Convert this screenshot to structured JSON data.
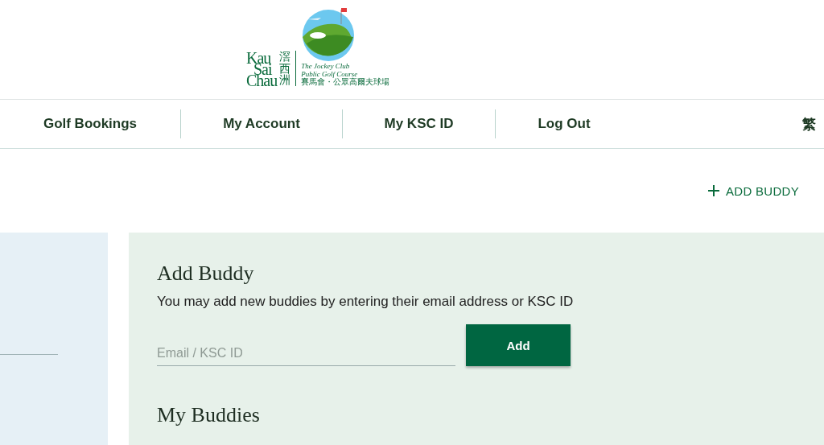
{
  "logo": {
    "name_lines": [
      "Kau",
      "Sai",
      "Chau"
    ],
    "chinese_name": "滘西洲",
    "subtitle_lines": [
      "The Jockey Club",
      "Public Golf Course"
    ],
    "chinese_subtitle": "賽馬會・公眾高爾夫球場"
  },
  "nav": [
    {
      "label": "Golf Bookings"
    },
    {
      "label": "My Account"
    },
    {
      "label": "My KSC ID"
    },
    {
      "label": "Log Out"
    }
  ],
  "language": "繁",
  "add_buddy_link": "ADD BUDDY",
  "add_buddy": {
    "title": "Add Buddy",
    "description": "You may add new buddies by entering their email address or KSC ID",
    "placeholder": "Email / KSC ID",
    "button": "Add"
  },
  "my_buddies": {
    "title": "My Buddies"
  }
}
